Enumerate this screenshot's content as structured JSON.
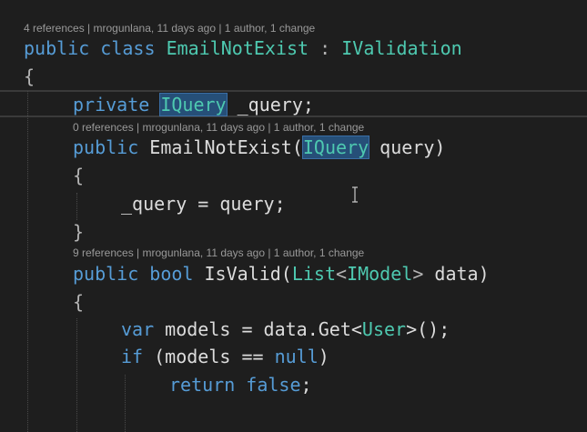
{
  "lenses": {
    "class": "4 references | mrogunlana, 11 days ago | 1 author, 1 change",
    "ctor": "0 references | mrogunlana, 11 days ago | 1 author, 1 change",
    "isvalid": "9 references | mrogunlana, 11 days ago | 1 author, 1 change"
  },
  "code": {
    "l1": {
      "kw1": "public",
      "kw2": "class",
      "name": "EmailNotExist",
      "colon": ":",
      "iface": "IValidation"
    },
    "l2": {
      "brace": "{"
    },
    "l3": {
      "kw": "private",
      "type": "IQuery",
      "field": "_query;"
    },
    "l4": {
      "kw": "public",
      "name": "EmailNotExist(",
      "type": "IQuery",
      "rest": "query)"
    },
    "l5": {
      "brace": "{"
    },
    "l6": {
      "text": "_query = query;"
    },
    "l7": {
      "brace": "}"
    },
    "l8": {
      "kw1": "public",
      "kw2": "bool",
      "name": "IsValid(",
      "t1": "List",
      "lt": "<",
      "t2": "IModel",
      "gt": ">",
      "rest": "data)"
    },
    "l9": {
      "brace": "{"
    },
    "l10": {
      "kw": "var",
      "pre": "models = data.Get<",
      "type": "User",
      "post": ">();"
    },
    "l11": {
      "kw": "if",
      "pre": "(models == ",
      "kwnull": "null",
      "post": ")"
    },
    "l12": {
      "kw": "return",
      "kwfalse": "false",
      "semi": ";"
    }
  }
}
